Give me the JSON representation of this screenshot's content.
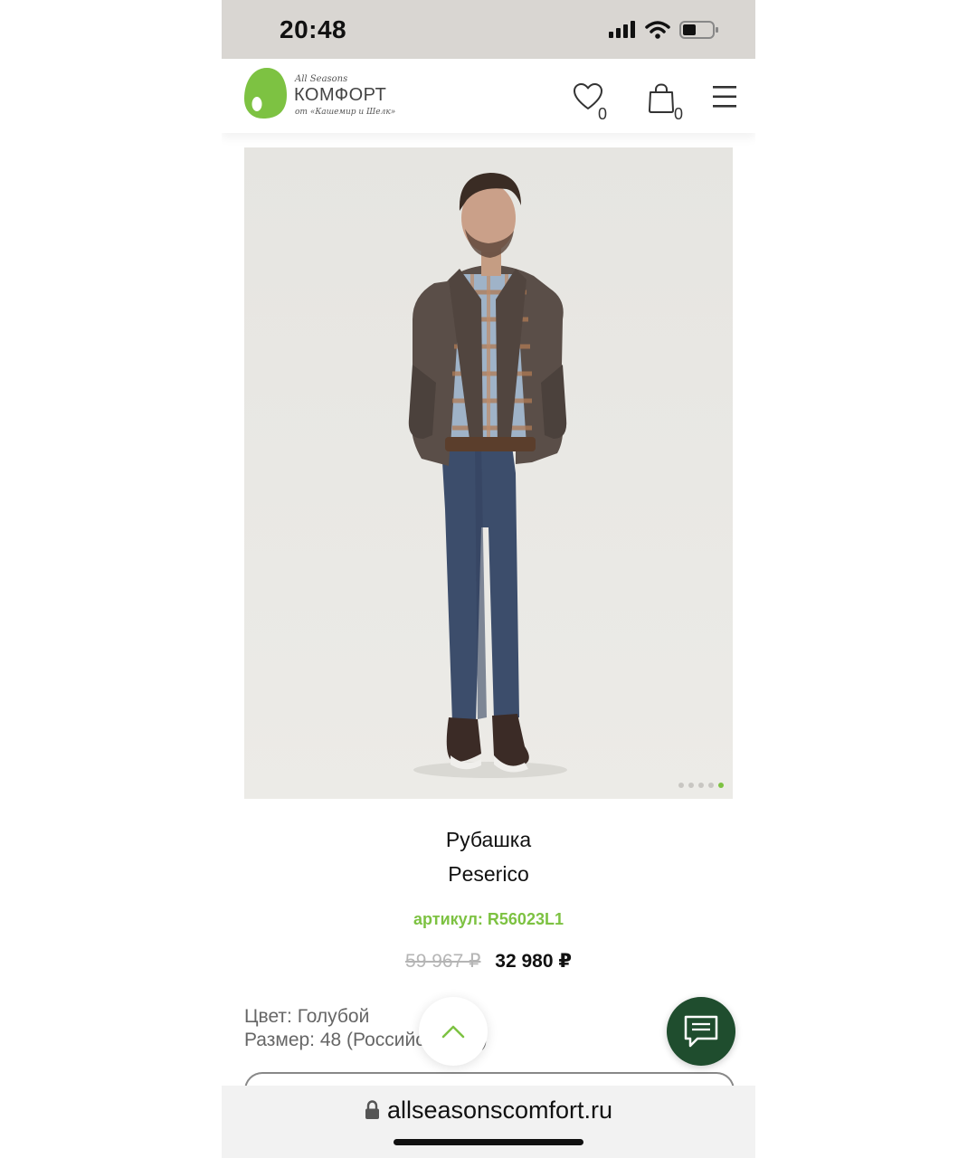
{
  "status_bar": {
    "time": "20:48"
  },
  "header": {
    "logo": {
      "top_line": "All Seasons",
      "brand": "КОМФОРТ",
      "bottom_line": "от «Кашемир и Шелк»"
    },
    "wishlist_count": "0",
    "cart_count": "0"
  },
  "gallery": {
    "slides_total": 5,
    "active_slide": 5
  },
  "product": {
    "type": "Рубашка",
    "brand": "Peserico",
    "sku_label": "артикул:",
    "sku": "R56023L1",
    "old_price": "59 967 ₽",
    "new_price": "32 980 ₽",
    "color_line": "Цвет: Голубой",
    "size_line": "Размер: 48 (Российский 48)"
  },
  "browser": {
    "url": "allseasonscomfort.ru"
  },
  "colors": {
    "accent": "#7dc242",
    "chat_button": "#1f4d2e",
    "status_bar": "#d9d6d2"
  }
}
